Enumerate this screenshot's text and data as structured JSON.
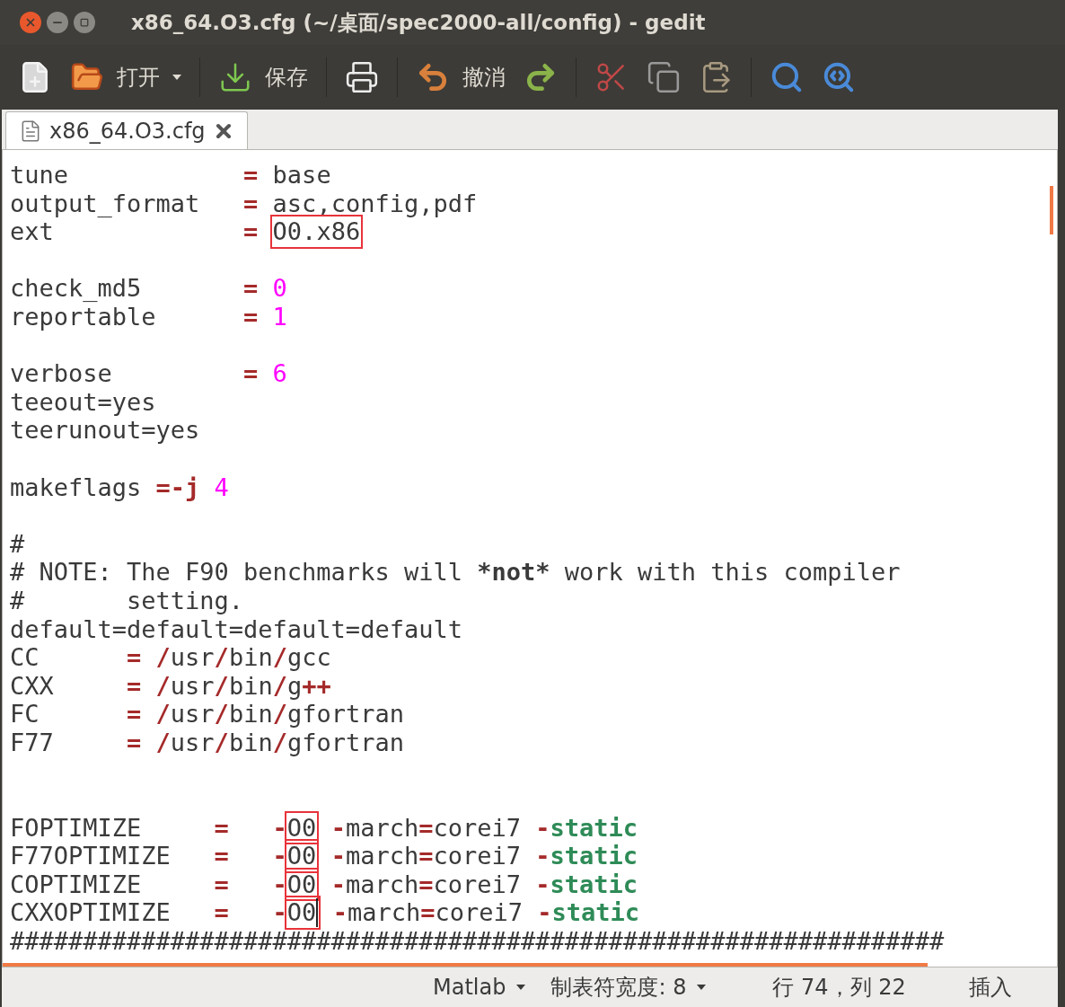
{
  "window": {
    "title": "x86_64.O3.cfg (~/桌面/spec2000-all/config) - gedit"
  },
  "toolbar": [
    {
      "kind": "new"
    },
    {
      "kind": "open",
      "label": "打开"
    },
    {
      "kind": "dropdown"
    },
    {
      "kind": "separator"
    },
    {
      "kind": "save",
      "label": "保存"
    },
    {
      "kind": "separator"
    },
    {
      "kind": "print"
    },
    {
      "kind": "separator"
    },
    {
      "kind": "undo",
      "label": "撤消"
    },
    {
      "kind": "redo"
    },
    {
      "kind": "separator"
    },
    {
      "kind": "cut"
    },
    {
      "kind": "copy"
    },
    {
      "kind": "paste"
    },
    {
      "kind": "separator"
    },
    {
      "kind": "search"
    },
    {
      "kind": "replace"
    }
  ],
  "tabs": [
    {
      "label": "x86_64.O3.cfg",
      "selected": true
    }
  ],
  "editor": {
    "lines": [
      {
        "kind": "code",
        "tokens": [
          {
            "text": "tune            ",
            "kind": "plain"
          },
          {
            "text": "= ",
            "kind": "op"
          },
          {
            "text": "base",
            "kind": "plain"
          }
        ]
      },
      {
        "kind": "code",
        "tokens": [
          {
            "text": "output_format   ",
            "kind": "plain"
          },
          {
            "text": "= ",
            "kind": "op"
          },
          {
            "text": "asc,config,pdf",
            "kind": "plain"
          }
        ]
      },
      {
        "kind": "code",
        "tokens": [
          {
            "text": "ext             ",
            "kind": "plain"
          },
          {
            "text": "= ",
            "kind": "op"
          },
          {
            "text": "O0.x86",
            "kind": "plain",
            "boxed": true
          }
        ]
      },
      {
        "kind": "blank"
      },
      {
        "kind": "code",
        "tokens": [
          {
            "text": "check_md5       ",
            "kind": "plain"
          },
          {
            "text": "= ",
            "kind": "op"
          },
          {
            "text": "0",
            "kind": "num"
          }
        ]
      },
      {
        "kind": "code",
        "tokens": [
          {
            "text": "reportable      ",
            "kind": "plain"
          },
          {
            "text": "= ",
            "kind": "op"
          },
          {
            "text": "1",
            "kind": "num"
          }
        ]
      },
      {
        "kind": "blank"
      },
      {
        "kind": "code",
        "tokens": [
          {
            "text": "verbose         ",
            "kind": "plain"
          },
          {
            "text": "= ",
            "kind": "op"
          },
          {
            "text": "6",
            "kind": "num"
          }
        ]
      },
      {
        "kind": "code",
        "tokens": [
          {
            "text": "teeout=yes",
            "kind": "plain"
          }
        ]
      },
      {
        "kind": "code",
        "tokens": [
          {
            "text": "teerunout=yes",
            "kind": "plain"
          }
        ]
      },
      {
        "kind": "blank"
      },
      {
        "kind": "code",
        "tokens": [
          {
            "text": "makeflags ",
            "kind": "plain"
          },
          {
            "text": "=-j ",
            "kind": "op"
          },
          {
            "text": "4",
            "kind": "num"
          }
        ]
      },
      {
        "kind": "blank"
      },
      {
        "kind": "code",
        "tokens": [
          {
            "text": "#",
            "kind": "plain"
          }
        ]
      },
      {
        "kind": "code",
        "tokens": [
          {
            "text": "# NOTE: The F90 benchmarks will ",
            "kind": "plain"
          },
          {
            "text": "*not*",
            "kind": "bold"
          },
          {
            "text": " work with this compiler",
            "kind": "plain"
          }
        ]
      },
      {
        "kind": "code",
        "tokens": [
          {
            "text": "#       setting.",
            "kind": "plain"
          }
        ]
      },
      {
        "kind": "code",
        "tokens": [
          {
            "text": "default=default=default=default",
            "kind": "plain"
          }
        ]
      },
      {
        "kind": "code",
        "tokens": [
          {
            "text": "CC      ",
            "kind": "plain"
          },
          {
            "text": "= /",
            "kind": "op"
          },
          {
            "text": "usr",
            "kind": "plain"
          },
          {
            "text": "/",
            "kind": "op"
          },
          {
            "text": "bin",
            "kind": "plain"
          },
          {
            "text": "/",
            "kind": "op"
          },
          {
            "text": "gcc",
            "kind": "plain"
          }
        ]
      },
      {
        "kind": "code",
        "tokens": [
          {
            "text": "CXX     ",
            "kind": "plain"
          },
          {
            "text": "= /",
            "kind": "op"
          },
          {
            "text": "usr",
            "kind": "plain"
          },
          {
            "text": "/",
            "kind": "op"
          },
          {
            "text": "bin",
            "kind": "plain"
          },
          {
            "text": "/",
            "kind": "op"
          },
          {
            "text": "g",
            "kind": "plain"
          },
          {
            "text": "++",
            "kind": "op"
          }
        ]
      },
      {
        "kind": "code",
        "tokens": [
          {
            "text": "FC      ",
            "kind": "plain"
          },
          {
            "text": "= /",
            "kind": "op"
          },
          {
            "text": "usr",
            "kind": "plain"
          },
          {
            "text": "/",
            "kind": "op"
          },
          {
            "text": "bin",
            "kind": "plain"
          },
          {
            "text": "/",
            "kind": "op"
          },
          {
            "text": "gfortran",
            "kind": "plain"
          }
        ]
      },
      {
        "kind": "code",
        "tokens": [
          {
            "text": "F77     ",
            "kind": "plain"
          },
          {
            "text": "= /",
            "kind": "op"
          },
          {
            "text": "usr",
            "kind": "plain"
          },
          {
            "text": "/",
            "kind": "op"
          },
          {
            "text": "bin",
            "kind": "plain"
          },
          {
            "text": "/",
            "kind": "op"
          },
          {
            "text": "gfortran",
            "kind": "plain"
          }
        ]
      },
      {
        "kind": "blank"
      },
      {
        "kind": "blank"
      },
      {
        "kind": "code",
        "tokens": [
          {
            "text": "FOPTIMIZE     ",
            "kind": "plain"
          },
          {
            "text": "=   -",
            "kind": "op"
          },
          {
            "text": "O0",
            "kind": "plain",
            "boxed": true
          },
          {
            "text": " -",
            "kind": "op"
          },
          {
            "text": "march",
            "kind": "plain"
          },
          {
            "text": "=",
            "kind": "op"
          },
          {
            "text": "corei7 ",
            "kind": "plain"
          },
          {
            "text": "-",
            "kind": "op"
          },
          {
            "text": "static",
            "kind": "keyword"
          }
        ]
      },
      {
        "kind": "code",
        "tokens": [
          {
            "text": "F77OPTIMIZE   ",
            "kind": "plain"
          },
          {
            "text": "=   -",
            "kind": "op"
          },
          {
            "text": "O0",
            "kind": "plain",
            "boxed": true
          },
          {
            "text": " -",
            "kind": "op"
          },
          {
            "text": "march",
            "kind": "plain"
          },
          {
            "text": "=",
            "kind": "op"
          },
          {
            "text": "corei7 ",
            "kind": "plain"
          },
          {
            "text": "-",
            "kind": "op"
          },
          {
            "text": "static",
            "kind": "keyword"
          }
        ]
      },
      {
        "kind": "code",
        "tokens": [
          {
            "text": "COPTIMIZE     ",
            "kind": "plain"
          },
          {
            "text": "=   -",
            "kind": "op"
          },
          {
            "text": "O0",
            "kind": "plain",
            "boxed": true
          },
          {
            "text": " -",
            "kind": "op"
          },
          {
            "text": "march",
            "kind": "plain"
          },
          {
            "text": "=",
            "kind": "op"
          },
          {
            "text": "corei7 ",
            "kind": "plain"
          },
          {
            "text": "-",
            "kind": "op"
          },
          {
            "text": "static",
            "kind": "keyword"
          }
        ]
      },
      {
        "kind": "code",
        "tokens": [
          {
            "text": "CXXOPTIMIZE   ",
            "kind": "plain"
          },
          {
            "text": "=   -",
            "kind": "op"
          },
          {
            "text": "O0",
            "kind": "plain",
            "boxed": true,
            "cursor": true
          },
          {
            "text": " -",
            "kind": "op"
          },
          {
            "text": "march",
            "kind": "plain"
          },
          {
            "text": "=",
            "kind": "op"
          },
          {
            "text": "corei7 ",
            "kind": "plain"
          },
          {
            "text": "-",
            "kind": "op"
          },
          {
            "text": "static",
            "kind": "keyword"
          }
        ]
      },
      {
        "kind": "code",
        "tokens": [
          {
            "text": "################################################################",
            "kind": "plain"
          }
        ]
      }
    ]
  },
  "status_bar": {
    "language": "Matlab",
    "tab_width": "制表符宽度: 8",
    "position": "行 74，列 22",
    "mode": "插入"
  }
}
